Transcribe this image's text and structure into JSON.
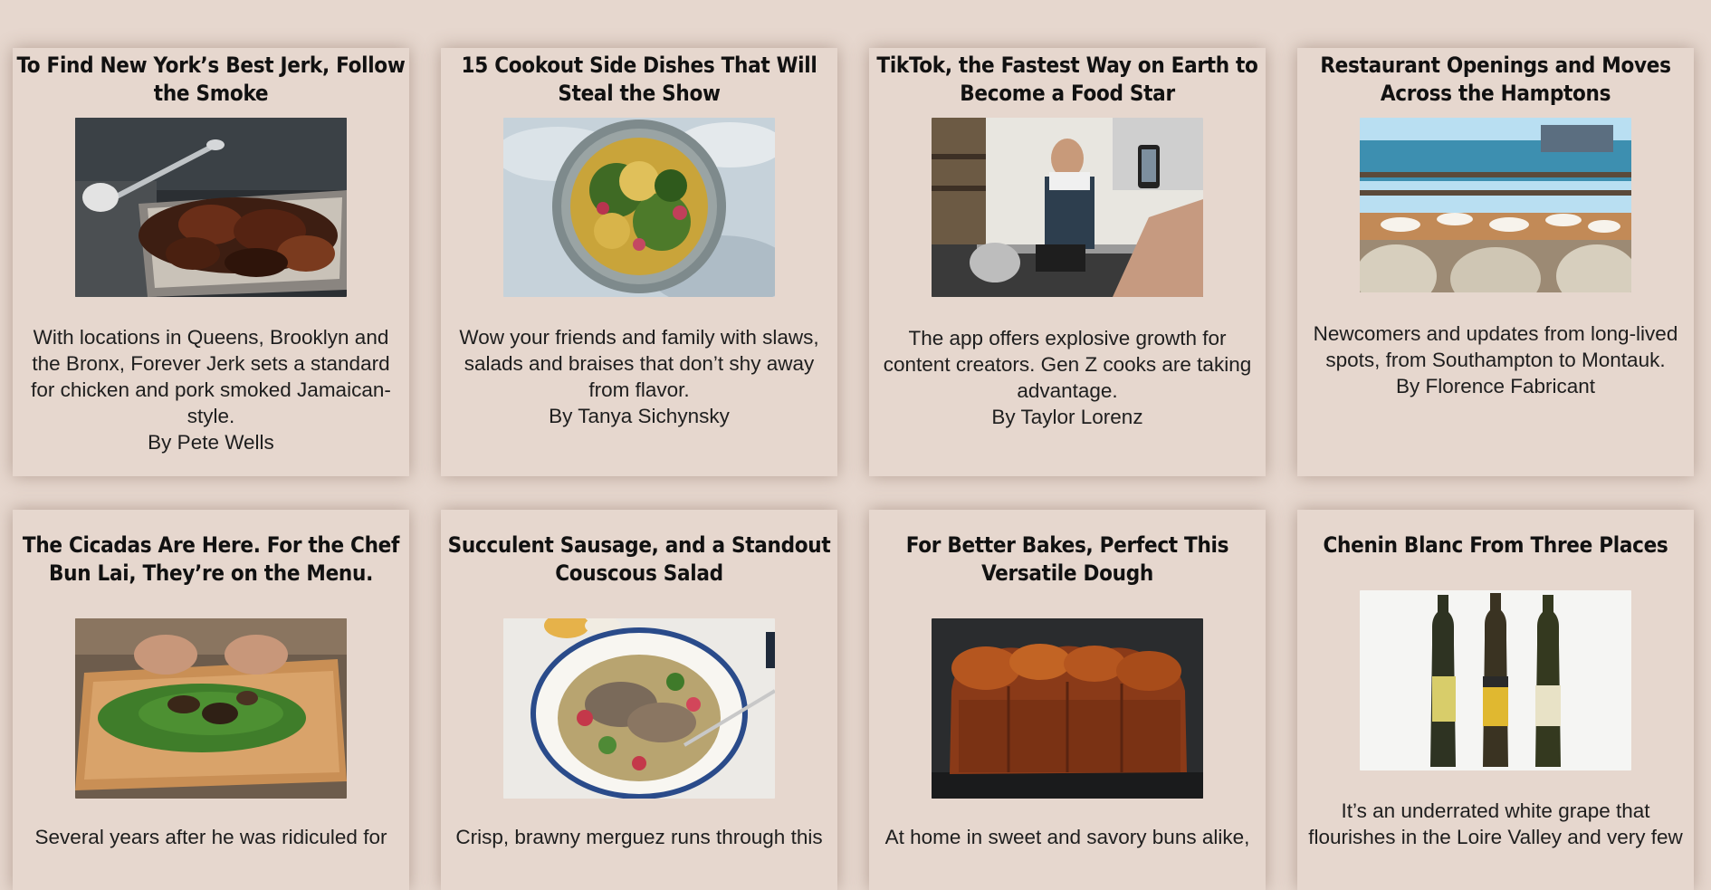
{
  "articles": [
    {
      "title": "To Find New York’s Best Jerk, Follow the Smoke",
      "description": "With locations in Queens, Brooklyn and the Bronx, Forever Jerk sets a standard for chicken and pork smoked Jamaican-style.",
      "byline": "By Pete Wells",
      "image": "jerk-chicken-grill-photo"
    },
    {
      "title": "15 Cookout Side Dishes That Will Steal the Show",
      "description": "Wow your friends and family with slaws, salads and braises that don’t shy away from flavor.",
      "byline": "By Tanya Sichynsky",
      "image": "salad-bowl-photo"
    },
    {
      "title": "TikTok, the Fastest Way on Earth to Become a Food Star",
      "description": "The app offers explosive growth for content creators. Gen Z cooks are taking advantage.",
      "byline": "By Taylor Lorenz",
      "image": "kitchen-cook-filming-photo"
    },
    {
      "title": "Restaurant Openings and Moves Across the Hamptons",
      "description": "Newcomers and updates from long-lived spots, from Southampton to Montauk.",
      "byline": "By Florence Fabricant",
      "image": "waterfront-dining-table-photo"
    },
    {
      "title": "The Cicadas Are Here. For the Chef Bun Lai, They’re on the Menu.",
      "description": "Several years after he was ridiculed for",
      "byline": "",
      "image": "cicada-dish-photo"
    },
    {
      "title": "Succulent Sausage, and a Standout Couscous Salad",
      "description": "Crisp, brawny merguez runs through this",
      "byline": "",
      "image": "sausage-couscous-platter-photo"
    },
    {
      "title": "For Better Bakes, Perfect This Versatile Dough",
      "description": "At home in sweet and savory buns alike,",
      "byline": "",
      "image": "brioche-loaf-photo"
    },
    {
      "title": "Chenin Blanc From Three Places",
      "description": "It’s an underrated white grape that flourishes in the Loire Valley and very few",
      "byline": "",
      "image": "wine-bottles-photo"
    }
  ],
  "colors": {
    "page_background": "#e6d7ce",
    "card_background": "#e6d7ce",
    "text": "#1e1e1e"
  }
}
